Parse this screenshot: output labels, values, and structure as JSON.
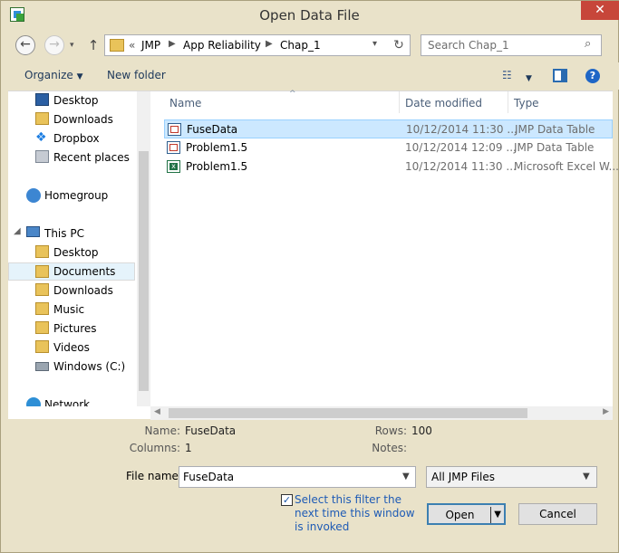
{
  "window": {
    "title": "Open Data File",
    "close_label": "✕"
  },
  "nav": {
    "back_icon": "←",
    "forward_icon": "→",
    "up_icon": "↑",
    "breadcrumb": [
      "«",
      "JMP",
      "App Reliability",
      "Chap_1"
    ],
    "search_placeholder": "Search Chap_1"
  },
  "toolbar": {
    "organize": "Organize",
    "new_folder": "New folder"
  },
  "sidebar": {
    "favorites": [
      "Desktop",
      "Downloads",
      "Dropbox",
      "Recent places"
    ],
    "homegroup": "Homegroup",
    "this_pc": "This PC",
    "pc_items": [
      "Desktop",
      "Documents",
      "Downloads",
      "Music",
      "Pictures",
      "Videos",
      "Windows (C:)"
    ],
    "network": "Network",
    "selected": "Documents"
  },
  "columns": {
    "name": "Name",
    "date": "Date modified",
    "type": "Type"
  },
  "files": [
    {
      "name": "FuseData",
      "date": "10/12/2014 11:30 ...",
      "type": "JMP Data Table",
      "selected": true
    },
    {
      "name": "Problem1.5",
      "date": "10/12/2014 12:09 ...",
      "type": "JMP Data Table",
      "selected": false
    },
    {
      "name": "Problem1.5",
      "date": "10/12/2014 11:30 ...",
      "type": "Microsoft Excel W...",
      "selected": false
    }
  ],
  "details": {
    "name_label": "Name:",
    "name_value": "FuseData",
    "columns_label": "Columns:",
    "columns_value": "1",
    "rows_label": "Rows:",
    "rows_value": "100",
    "notes_label": "Notes:"
  },
  "footer": {
    "file_name_label": "File name:",
    "file_name_value": "FuseData",
    "filter_value": "All JMP Files",
    "checkbox_checked": true,
    "checkbox_text": "Select this filter the next time this window is invoked",
    "open_label": "Open",
    "cancel_label": "Cancel"
  },
  "colors": {
    "accent": "#1f66c6",
    "selection": "#cce8ff",
    "chrome": "#e9e2c9"
  }
}
